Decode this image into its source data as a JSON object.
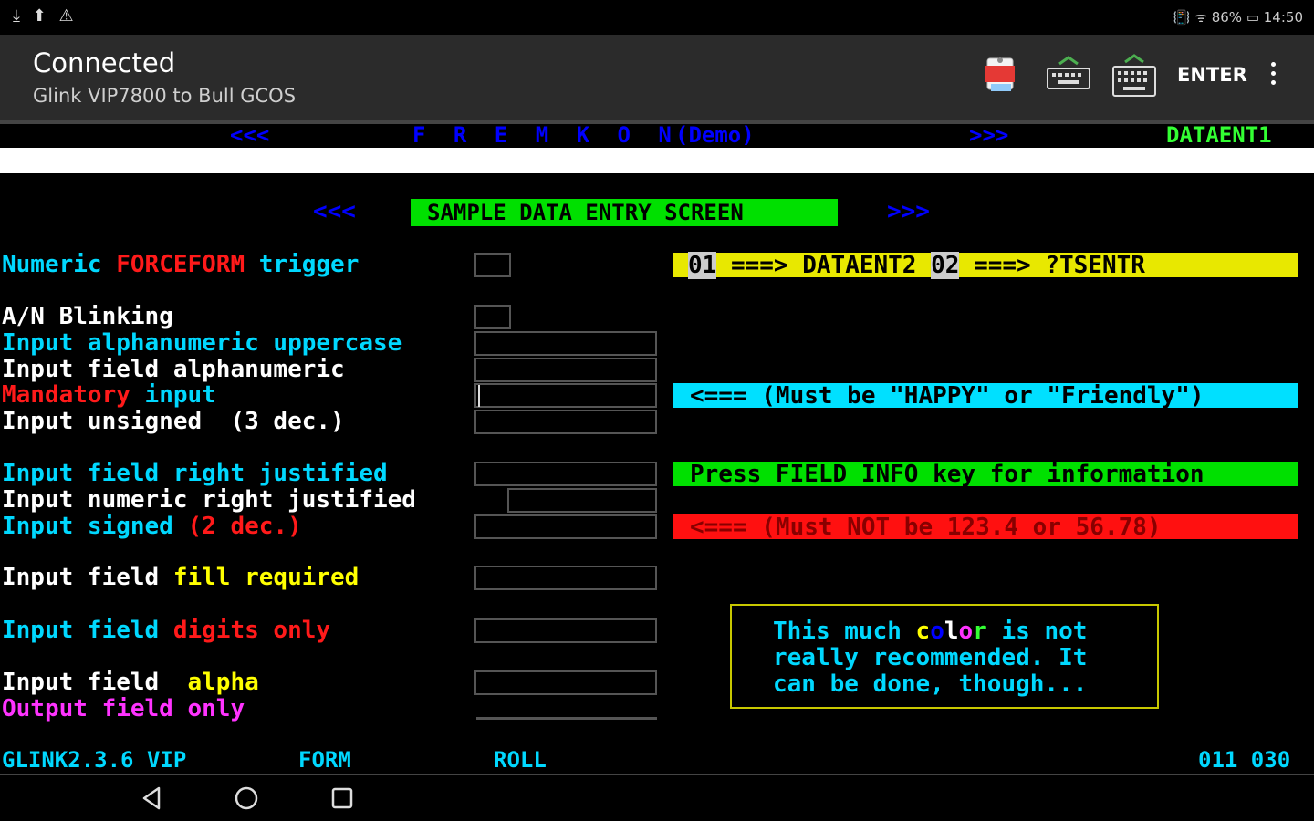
{
  "statusbar": {
    "left_icons": "⤓ ⬆ ⚠",
    "right_text": "📳 ᯤ 86% ▭ 14:50"
  },
  "appbar": {
    "title": "Connected",
    "subtitle": "Glink VIP7800 to Bull GCOS",
    "enter_label": "ENTER",
    "icons": [
      "clipboard-icon",
      "keyboard-hide-icon",
      "keyboard-show-icon",
      "overflow-menu-icon"
    ]
  },
  "terminal": {
    "header": {
      "left_arrows": "<<<",
      "title": "F R E M K O N",
      "demo": "(Demo)",
      "right_arrows": ">>>",
      "screen_id": "DATAENT1"
    },
    "section": {
      "left_arrows": "<<<",
      "title": "SAMPLE DATA ENTRY SCREEN",
      "right_arrows": ">>>"
    },
    "labels": {
      "numeric_a": "Numeric ",
      "numeric_b": "FORCEFORM",
      "numeric_c": " trigger",
      "blinking": "A/N Blinking",
      "upper": "Input alphanumeric uppercase",
      "alnum": "Input field alphanumeric",
      "mand_a": "Mandatory",
      "mand_b": " input",
      "unsigned": "Input unsigned  (3 dec.)",
      "rjust": "Input field right justified",
      "nrjust": "Input numeric right justified",
      "signed_a": "Input signed ",
      "signed_b": "(2 dec.)",
      "fill_a": "Input field ",
      "fill_b": "fill required",
      "digits_a": "Input field ",
      "digits_b": "digits only",
      "alpha_a": "Input field  ",
      "alpha_b": "alpha",
      "output": "Output field only"
    },
    "bars": {
      "nav_num1": "01",
      "nav_arrow1": " ===> DATAENT2 ",
      "nav_num2": "02",
      "nav_arrow2": " ===> ?TSENTR",
      "happy": "<=== (Must be \"HAPPY\" or \"Friendly\")",
      "field_info": "Press FIELD INFO key for information",
      "not_value": "<=== (Must NOT be 123.4 or 56.78)"
    },
    "note": {
      "l1_a": "This much ",
      "l1_c": "c",
      "l1_o": "o",
      "l1_l": "l",
      "l1_o2": "o",
      "l1_r": "r",
      "l1_b": " is not",
      "l2": "really recommended. It",
      "l3": "can be done, though..."
    },
    "footer": {
      "version": "GLINK2.3.6 VIP",
      "mode1": "FORM",
      "mode2": "ROLL",
      "position": "011 030"
    }
  },
  "navbar": {
    "icons": [
      "back-icon",
      "home-icon",
      "recents-icon"
    ]
  },
  "colors": {
    "appbar": "#2b2b2b",
    "green": "#00e000",
    "yellow": "#e8e800",
    "cyan": "#00e0ff",
    "red": "#ff1010",
    "blue": "#0000ff"
  }
}
